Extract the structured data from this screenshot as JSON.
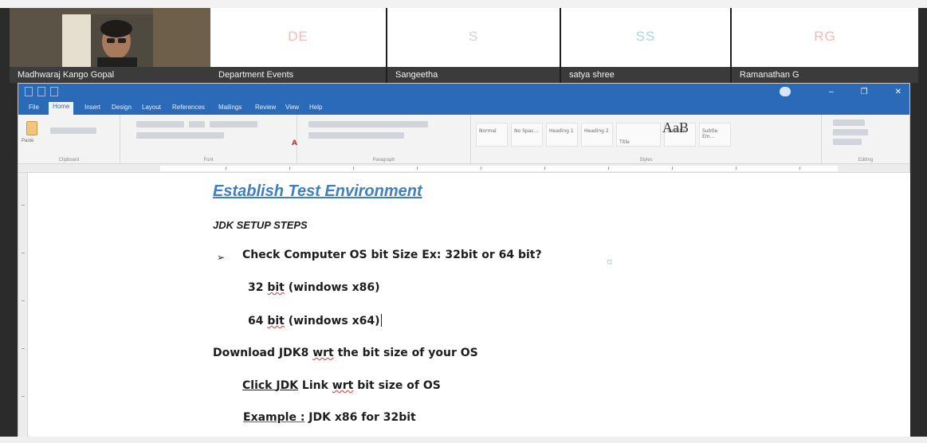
{
  "meeting": {
    "participants": [
      {
        "initials": "",
        "name": "Madhwaraj Kango Gopal"
      },
      {
        "initials": "DE",
        "name": "Department Events"
      },
      {
        "initials": "S",
        "name": "Sangeetha"
      },
      {
        "initials": "SS",
        "name": "satya shree"
      },
      {
        "initials": "RG",
        "name": "Ramanathan G"
      }
    ]
  },
  "word": {
    "window_title": "",
    "account": "",
    "tabs": [
      "File",
      "Home",
      "Insert",
      "Design",
      "Layout",
      "References",
      "Mailings",
      "Review",
      "View",
      "Help"
    ],
    "tell_me": "",
    "share_label": "",
    "ribbon_groups": [
      "Clipboard",
      "Font",
      "Paragraph",
      "Styles",
      "Editing"
    ],
    "clipboard_paste": "Paste",
    "style_sample": "AaB",
    "styles": [
      "Normal",
      "No Spac...",
      "Heading 1",
      "Heading 2",
      "Title",
      "Subtitle",
      "Subtle Em..."
    ]
  },
  "document": {
    "heading": "Establish Test Environment",
    "subheading": "JDK SETUP STEPS",
    "bullet_symbol": "➢",
    "bullet_item": "Check Computer OS bit Size  Ex: 32bit or 64 bit?",
    "option_32_pre": "32 ",
    "option_32_word": "bit",
    "option_32_post": " (windows x86)",
    "option_64_pre": "64 ",
    "option_64_word": "bit",
    "option_64_post": " (windows x64)",
    "download_pre": "Download JDK8 ",
    "download_wrt": "wrt",
    "download_post": " the bit size of your OS",
    "click_pre": "Click  ",
    "click_jdk": "JDK",
    "click_mid": " Link ",
    "click_wrt": "wrt",
    "click_post": " bit size of OS",
    "example_label": "Example :",
    "example_value": " JDK x86 for 32bit"
  }
}
